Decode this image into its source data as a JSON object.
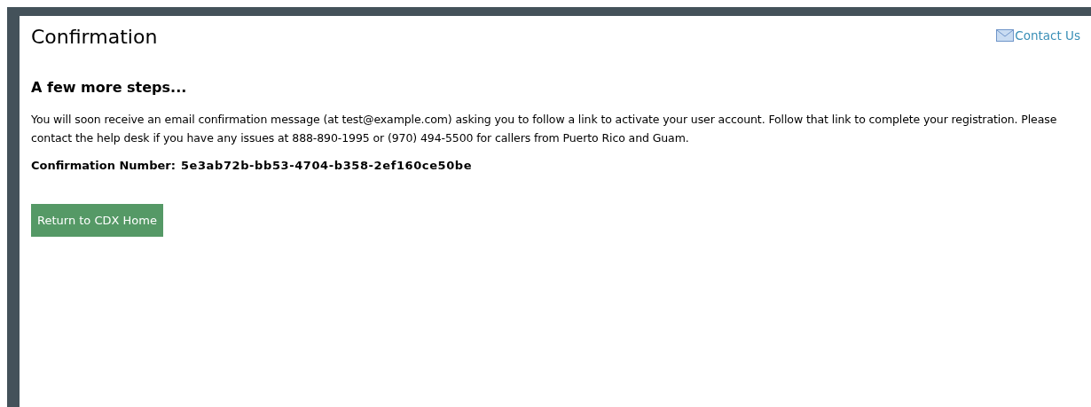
{
  "page": {
    "title": "Confirmation",
    "contact_link": "Contact Us"
  },
  "section": {
    "heading": "A few more steps...",
    "message": "You will soon receive an email confirmation message (at test@example.com) asking you to follow a link to activate your user account. Follow that link to complete your registration. Please contact the help desk if you have any issues at 888-890-1995 or (970) 494-5500 for callers from Puerto Rico and Guam.",
    "confirmation_label": "Confirmation Number:",
    "confirmation_number": "5e3ab72b-bb53-4704-b358-2ef160ce50be"
  },
  "buttons": [
    "Return to CDX Home"
  ]
}
